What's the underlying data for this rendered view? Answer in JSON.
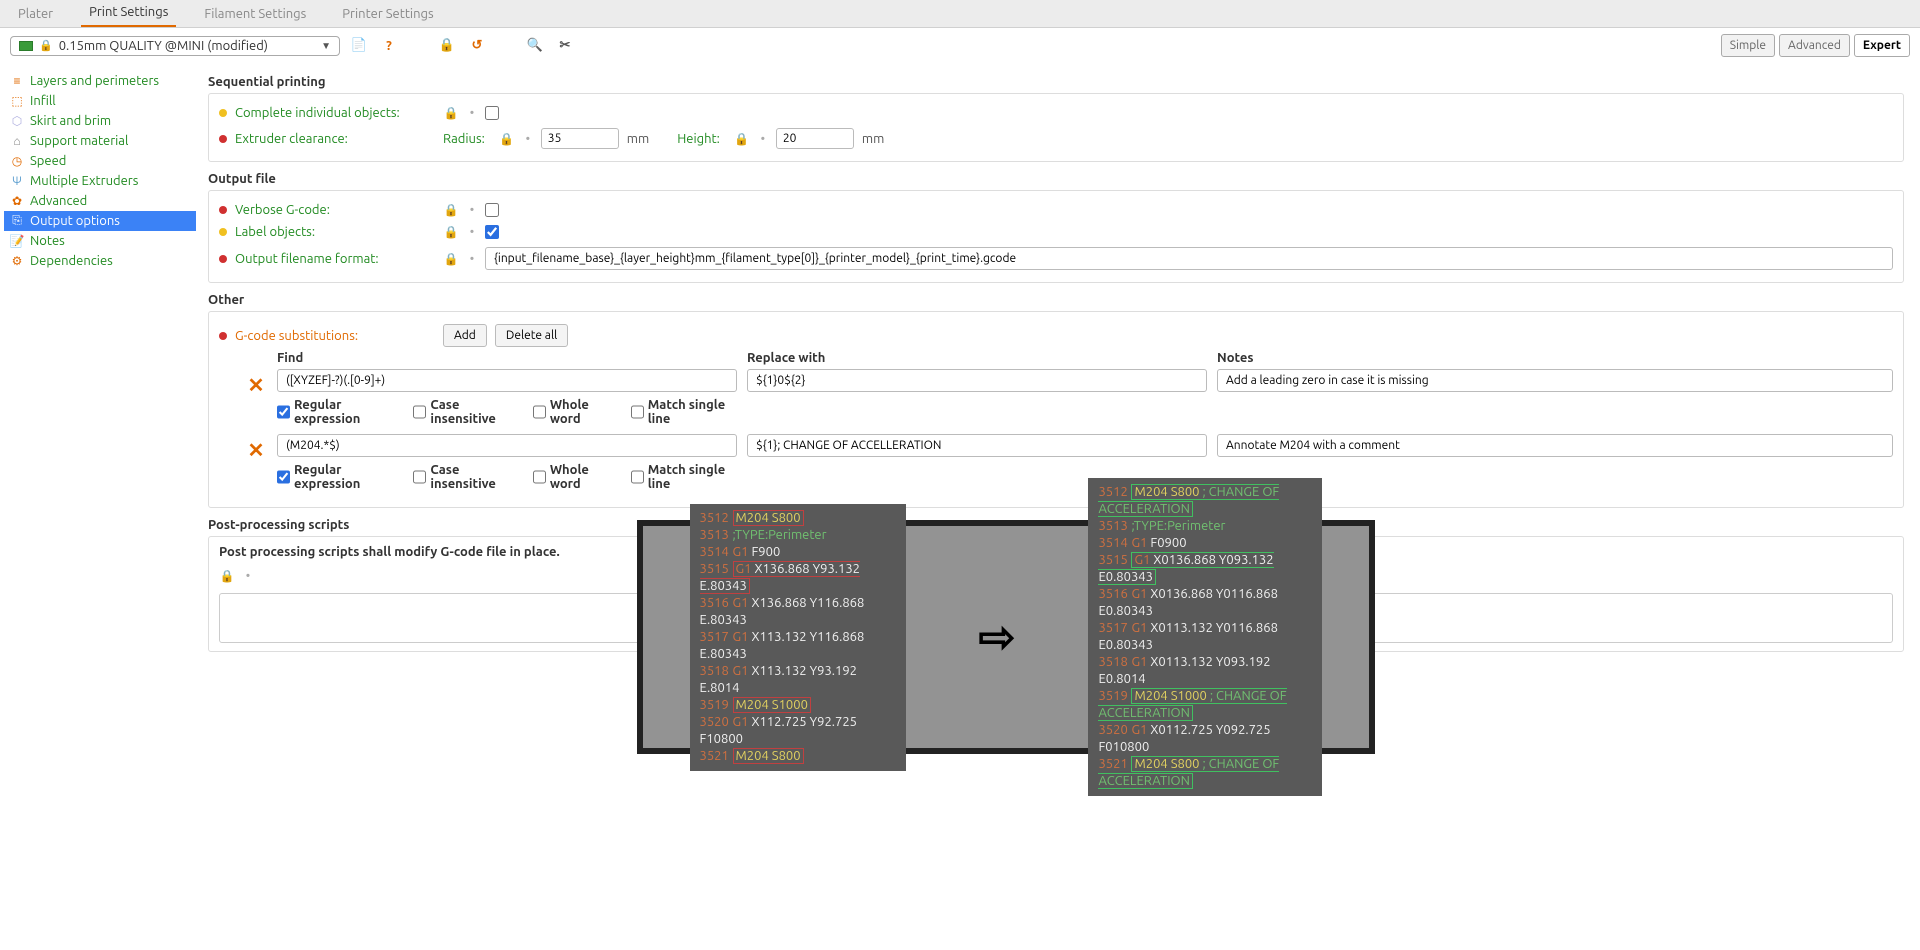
{
  "tabs": {
    "plater": "Plater",
    "print": "Print Settings",
    "filament": "Filament Settings",
    "printer": "Printer Settings"
  },
  "preset": "0.15mm QUALITY @MINI (modified)",
  "modes": {
    "simple": "Simple",
    "advanced": "Advanced",
    "expert": "Expert"
  },
  "sidebar": {
    "items": [
      "Layers and perimeters",
      "Infill",
      "Skirt and brim",
      "Support material",
      "Speed",
      "Multiple Extruders",
      "Advanced",
      "Output options",
      "Notes",
      "Dependencies"
    ]
  },
  "sections": {
    "seq": "Sequential printing",
    "output": "Output file",
    "other": "Other",
    "pp": "Post-processing scripts"
  },
  "seq": {
    "complete": "Complete individual objects:",
    "clearance": "Extruder clearance:",
    "radius": "Radius:",
    "radius_val": "35",
    "radius_unit": "mm",
    "height": "Height:",
    "height_val": "20",
    "height_unit": "mm"
  },
  "output": {
    "verbose": "Verbose G-code:",
    "labelobj": "Label objects:",
    "fname": "Output filename format:",
    "fname_val": "{input_filename_base}_{layer_height}mm_{filament_type[0]}_{printer_model}_{print_time}.gcode"
  },
  "other": {
    "subst": "G-code substitutions:",
    "add": "Add",
    "deleteall": "Delete all",
    "h_find": "Find",
    "h_replace": "Replace with",
    "h_notes": "Notes",
    "chk_regex": "Regular expression",
    "chk_case": "Case insensitive",
    "chk_whole": "Whole word",
    "chk_single": "Match single line",
    "rows": [
      {
        "find": "([XYZEF]-?)(.[0-9]+)",
        "replace": "${1}0${2}",
        "notes": "Add a leading zero in case it is missing",
        "regex": true
      },
      {
        "find": "(M204.*$)",
        "replace": "${1}; CHANGE OF ACCELLERATION",
        "notes": "Annotate M204 with a comment",
        "regex": true
      }
    ]
  },
  "pp": {
    "note": "Post processing scripts shall modify G-code file in place."
  },
  "gcode": {
    "left": [
      {
        "n": "3512",
        "t": "m",
        "c": "M204 S800",
        "box": "red"
      },
      {
        "n": "3513",
        "t": "c",
        "c": ";TYPE:Perimeter"
      },
      {
        "n": "3514",
        "t": "g",
        "c": "G1 F900"
      },
      {
        "n": "3515",
        "t": "g",
        "c": "G1 X136.868 Y93.132 E.80343",
        "box": "red"
      },
      {
        "n": "3516",
        "t": "g",
        "c": "G1 X136.868 Y116.868 E.80343"
      },
      {
        "n": "3517",
        "t": "g",
        "c": "G1 X113.132 Y116.868 E.80343"
      },
      {
        "n": "3518",
        "t": "g",
        "c": "G1 X113.132 Y93.192 E.8014"
      },
      {
        "n": "3519",
        "t": "m",
        "c": "M204 S1000",
        "box": "red"
      },
      {
        "n": "3520",
        "t": "g",
        "c": "G1 X112.725 Y92.725 F10800"
      },
      {
        "n": "3521",
        "t": "m",
        "c": "M204 S800",
        "box": "red"
      }
    ],
    "right": [
      {
        "n": "3512",
        "t": "m",
        "c": "M204 S800",
        "ext": "; CHANGE OF ACCELERATION",
        "box": "green"
      },
      {
        "n": "3513",
        "t": "c",
        "c": ";TYPE:Perimeter"
      },
      {
        "n": "3514",
        "t": "g",
        "c": "G1 F0900"
      },
      {
        "n": "3515",
        "t": "g",
        "c": "G1 X0136.868 Y093.132 E0.80343",
        "box": "green"
      },
      {
        "n": "3516",
        "t": "g",
        "c": "G1 X0136.868 Y0116.868 E0.80343"
      },
      {
        "n": "3517",
        "t": "g",
        "c": "G1 X0113.132 Y0116.868 E0.80343"
      },
      {
        "n": "3518",
        "t": "g",
        "c": "G1 X0113.132 Y093.192 E0.8014"
      },
      {
        "n": "3519",
        "t": "m",
        "c": "M204 S1000",
        "ext": "; CHANGE OF ACCELERATION",
        "box": "green"
      },
      {
        "n": "3520",
        "t": "g",
        "c": "G1 X0112.725 Y092.725 F010800"
      },
      {
        "n": "3521",
        "t": "m",
        "c": "M204 S800",
        "ext": "; CHANGE OF ACCELERATION",
        "box": "green"
      }
    ]
  }
}
